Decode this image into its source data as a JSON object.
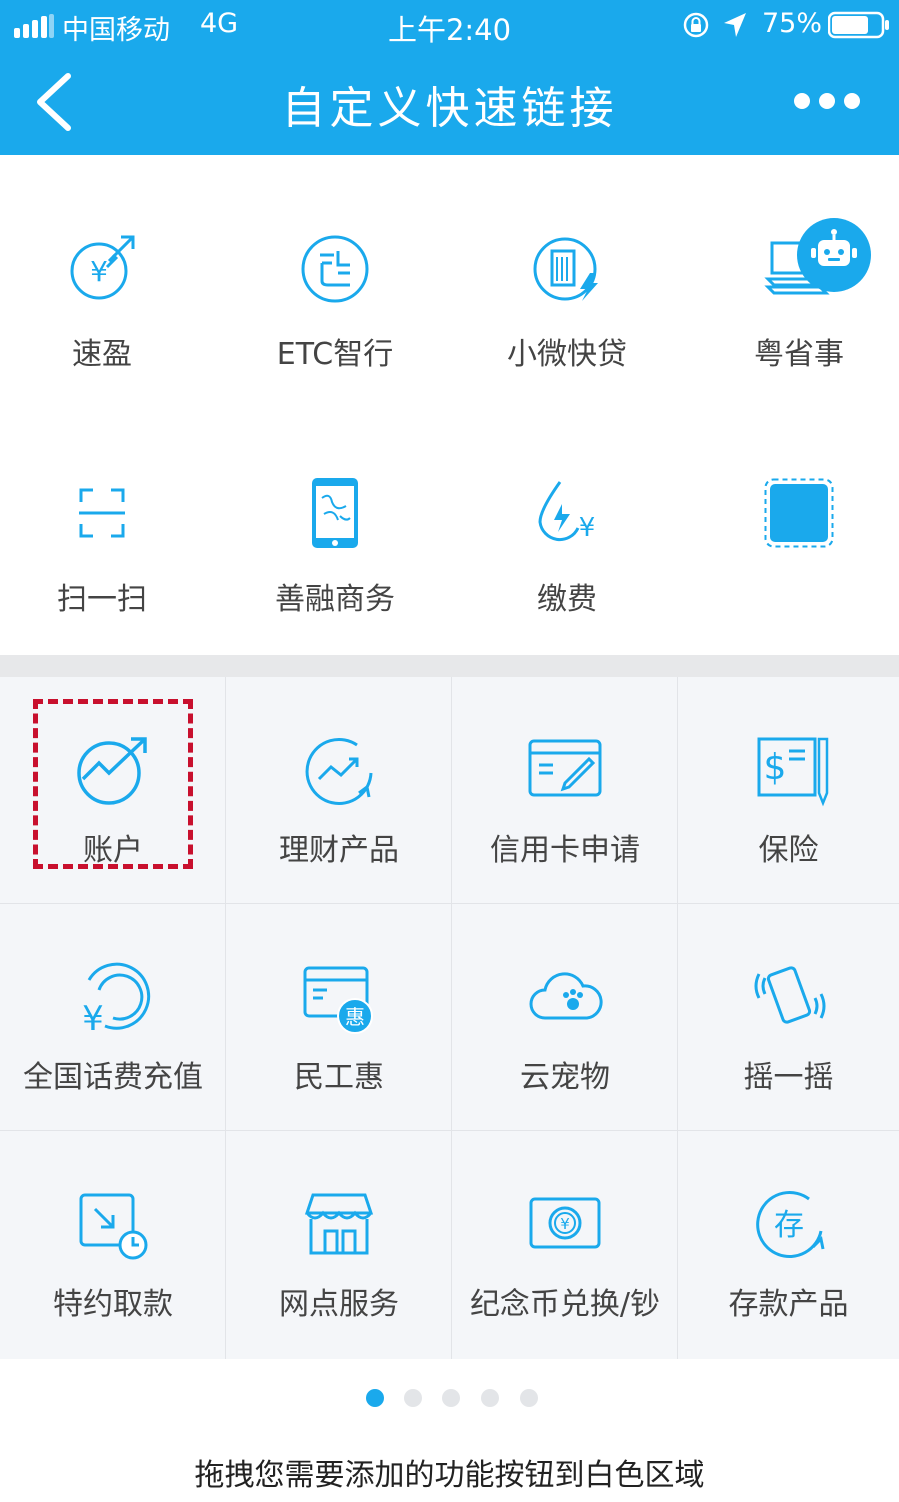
{
  "status_bar": {
    "carrier": "中国移动",
    "network": "4G",
    "time": "上午2:40",
    "battery_percent": "75%",
    "battery_level": 0.75
  },
  "nav": {
    "title": "自定义快速链接",
    "back_icon": "chevron-left-icon",
    "more_icon": "more-dots-icon"
  },
  "shortcuts": [
    {
      "label": "速盈",
      "icon": "yuan-growth-icon"
    },
    {
      "label": "ETC智行",
      "icon": "etc-icon"
    },
    {
      "label": "小微快贷",
      "icon": "building-loan-icon"
    },
    {
      "label": "粤省事",
      "icon": "cards-stack-icon"
    },
    {
      "label": "扫一扫",
      "icon": "scan-icon"
    },
    {
      "label": "善融商务",
      "icon": "phone-shop-icon"
    },
    {
      "label": "缴费",
      "icon": "water-yuan-icon"
    },
    {
      "label": "",
      "icon": "empty-slot-icon"
    }
  ],
  "functions": [
    {
      "label": "账户",
      "icon": "account-growth-icon"
    },
    {
      "label": "理财产品",
      "icon": "finance-trend-icon"
    },
    {
      "label": "信用卡申请",
      "icon": "card-pen-icon"
    },
    {
      "label": "保险",
      "icon": "dollar-document-icon"
    },
    {
      "label": "全国话费充值",
      "icon": "yuan-refresh-icon"
    },
    {
      "label": "民工惠",
      "icon": "card-hui-icon"
    },
    {
      "label": "云宠物",
      "icon": "cloud-paw-icon"
    },
    {
      "label": "摇一摇",
      "icon": "shake-phone-icon"
    },
    {
      "label": "特约取款",
      "icon": "withdraw-clock-icon"
    },
    {
      "label": "网点服务",
      "icon": "storefront-icon"
    },
    {
      "label": "纪念币兑换/钞",
      "icon": "coin-exchange-icon"
    },
    {
      "label": "存款产品",
      "icon": "deposit-icon"
    }
  ],
  "pagination": {
    "pages": 5,
    "active": 1
  },
  "hint": "拖拽您需要添加的功能按钮到白色区域",
  "colors": {
    "accent": "#1aa9ec",
    "highlight": "#c8102e"
  }
}
